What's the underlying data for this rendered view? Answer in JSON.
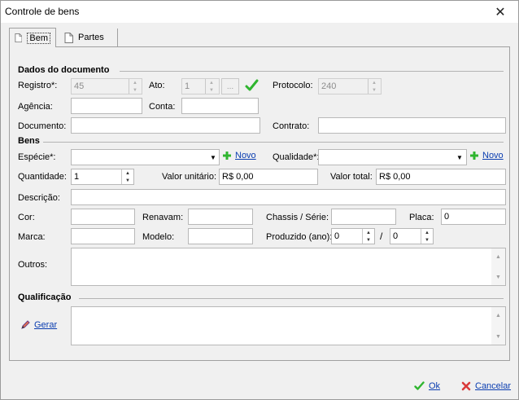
{
  "window": {
    "title": "Controle de bens",
    "close_glyph": "✕"
  },
  "tabs": [
    {
      "label": "Bem",
      "icon": "document-icon",
      "active": true
    },
    {
      "label": "Partes",
      "icon": "document-icon",
      "active": false
    }
  ],
  "documento": {
    "section_title": "Dados do documento",
    "registro_label": "Registro*:",
    "registro_value": "45",
    "ato_label": "Ato:",
    "ato_value": "1",
    "ato_button": "...",
    "protocolo_label": "Protocolo:",
    "protocolo_value": "240",
    "agencia_label": "Agência:",
    "agencia_value": "",
    "conta_label": "Conta:",
    "conta_value": "",
    "documento_label": "Documento:",
    "documento_value": "",
    "contrato_label": "Contrato:",
    "contrato_value": ""
  },
  "bens": {
    "section_title": "Bens",
    "especie_label": "Espécie*:",
    "especie_value": "",
    "novo_label": "Novo",
    "qualidade_label": "Qualidade*:",
    "qualidade_value": "",
    "quantidade_label": "Quantidade:",
    "quantidade_value": "1",
    "valor_unitario_label": "Valor unitário:",
    "valor_unitario_value": "R$ 0,00",
    "valor_total_label": "Valor total:",
    "valor_total_value": "R$ 0,00",
    "descricao_label": "Descrição:",
    "descricao_value": "",
    "cor_label": "Cor:",
    "cor_value": "",
    "renavam_label": "Renavam:",
    "renavam_value": "",
    "chassis_label": "Chassis / Série:",
    "chassis_value": "",
    "placa_label": "Placa:",
    "placa_value": "0",
    "marca_label": "Marca:",
    "marca_value": "",
    "modelo_label": "Modelo:",
    "modelo_value": "",
    "produzido_label": "Produzido (ano):",
    "produzido_de": "0",
    "produzido_sep": "/",
    "produzido_ate": "0",
    "outros_label": "Outros:"
  },
  "qualificacao": {
    "section_title": "Qualificação",
    "gerar_label": "Gerar"
  },
  "footer": {
    "ok_label": "Ok",
    "cancelar_label": "Cancelar"
  },
  "colors": {
    "accent_link": "#0a3db0",
    "check_green": "#2fb52f",
    "cancel_red": "#d93a3a"
  }
}
